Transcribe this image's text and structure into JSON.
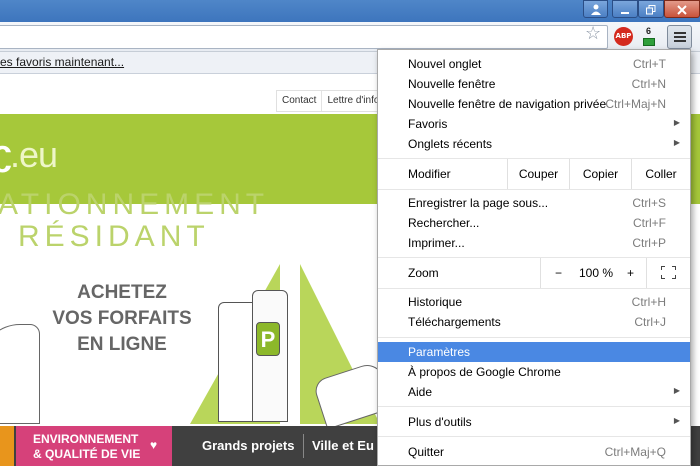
{
  "browser": {
    "bookmarks_bar_text": "es favoris maintenant...",
    "abp_label": "ABP",
    "extension_count": "6"
  },
  "page": {
    "top_links": [
      "Contact",
      "Lettre d'info"
    ],
    "logo_text": ".eu",
    "headline_line1": "ATIONNEMENT",
    "headline_line2": "RÉSIDANT",
    "promo_lines": [
      "ACHETEZ",
      "VOS FORFAITS",
      "EN LIGNE"
    ],
    "parking_sign": "P",
    "nav": {
      "env_line1": "ENVIRONNEMENT",
      "env_line2": "& QUALITÉ DE VIE",
      "env_icon": "♥",
      "grands_projets": "Grands projets",
      "ville": "Ville et Eu"
    }
  },
  "menu": {
    "nouvel_onglet": {
      "label": "Nouvel onglet",
      "shortcut": "Ctrl+T"
    },
    "nouvelle_fenetre": {
      "label": "Nouvelle fenêtre",
      "shortcut": "Ctrl+N"
    },
    "navigation_privee": {
      "label": "Nouvelle fenêtre de navigation privée",
      "shortcut": "Ctrl+Maj+N"
    },
    "favoris": {
      "label": "Favoris"
    },
    "onglets_recents": {
      "label": "Onglets récents"
    },
    "edit": {
      "label": "Modifier",
      "cut": "Couper",
      "copy": "Copier",
      "paste": "Coller"
    },
    "enregistrer": {
      "label": "Enregistrer la page sous...",
      "shortcut": "Ctrl+S"
    },
    "rechercher": {
      "label": "Rechercher...",
      "shortcut": "Ctrl+F"
    },
    "imprimer": {
      "label": "Imprimer...",
      "shortcut": "Ctrl+P"
    },
    "zoom": {
      "label": "Zoom",
      "minus": "−",
      "value": "100 %",
      "plus": "+"
    },
    "historique": {
      "label": "Historique",
      "shortcut": "Ctrl+H"
    },
    "telechargements": {
      "label": "Téléchargements",
      "shortcut": "Ctrl+J"
    },
    "parametres": {
      "label": "Paramètres"
    },
    "a_propos": {
      "label": "À propos de Google Chrome"
    },
    "aide": {
      "label": "Aide"
    },
    "plus_outils": {
      "label": "Plus d'outils"
    },
    "quitter": {
      "label": "Quitter",
      "shortcut": "Ctrl+Maj+Q"
    }
  },
  "colors": {
    "highlight": "#4a88e3",
    "hero_green": "#a6c83a",
    "nav_pink": "#d6417a"
  }
}
